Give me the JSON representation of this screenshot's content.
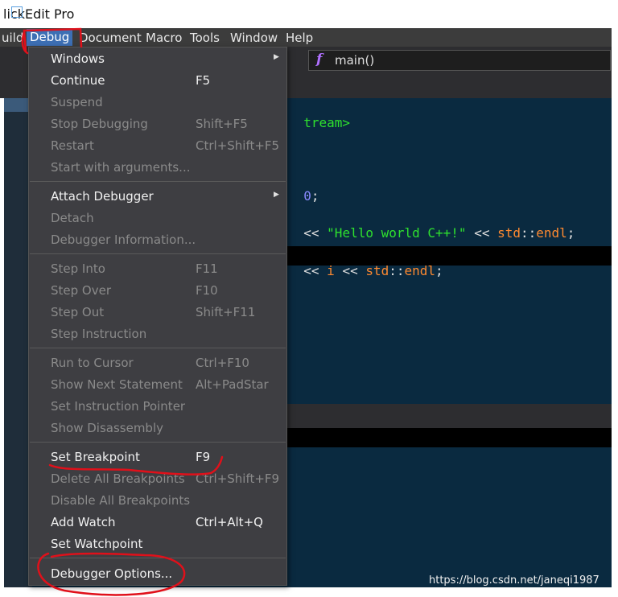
{
  "window": {
    "title": "lickEdit Pro"
  },
  "menubar": {
    "items": [
      "uild",
      "Debug",
      "Document",
      "Macro",
      "Tools",
      "Window",
      "Help"
    ]
  },
  "toolbar": {
    "proc_label": "main()",
    "proc_icon": "f"
  },
  "code": {
    "line1": "tream>",
    "line2_a": "0",
    "line2_b": ";",
    "line3_a": "<< ",
    "line3_str": "\"Hello world C++!\"",
    "line3_b": " << ",
    "line3_std": "std",
    "line3_sep": "::",
    "line3_endl": "endl",
    "line3_end": ";",
    "line4_a": "<< ",
    "line4_i": "i",
    "line4_b": " << ",
    "line4_std": "std",
    "line4_sep": "::",
    "line4_endl": "endl",
    "line4_end": ";"
  },
  "debug_menu": {
    "items": [
      {
        "label": "Windows",
        "shortcut": "",
        "enabled": true,
        "submenu": true
      },
      {
        "label": "Continue",
        "shortcut": "F5",
        "enabled": true
      },
      {
        "label": "Suspend",
        "shortcut": "",
        "enabled": false
      },
      {
        "label": "Stop Debugging",
        "shortcut": "Shift+F5",
        "enabled": false
      },
      {
        "label": "Restart",
        "shortcut": "Ctrl+Shift+F5",
        "enabled": false
      },
      {
        "label": "Start with arguments...",
        "shortcut": "",
        "enabled": false
      },
      {
        "label": "Attach Debugger",
        "shortcut": "",
        "enabled": true,
        "submenu": true
      },
      {
        "label": "Detach",
        "shortcut": "",
        "enabled": false
      },
      {
        "label": "Debugger Information...",
        "shortcut": "",
        "enabled": false
      },
      {
        "label": "Step Into",
        "shortcut": "F11",
        "enabled": false
      },
      {
        "label": "Step Over",
        "shortcut": "F10",
        "enabled": false
      },
      {
        "label": "Step Out",
        "shortcut": "Shift+F11",
        "enabled": false
      },
      {
        "label": "Step Instruction",
        "shortcut": "",
        "enabled": false
      },
      {
        "label": "Run to Cursor",
        "shortcut": "Ctrl+F10",
        "enabled": false
      },
      {
        "label": "Show Next Statement",
        "shortcut": "Alt+PadStar",
        "enabled": false
      },
      {
        "label": "Set Instruction Pointer",
        "shortcut": "",
        "enabled": false
      },
      {
        "label": "Show Disassembly",
        "shortcut": "",
        "enabled": false
      },
      {
        "label": "Set Breakpoint",
        "shortcut": "F9",
        "enabled": true
      },
      {
        "label": "Delete All Breakpoints",
        "shortcut": "Ctrl+Shift+F9",
        "enabled": false
      },
      {
        "label": "Disable All Breakpoints",
        "shortcut": "",
        "enabled": false
      },
      {
        "label": "Add Watch",
        "shortcut": "Ctrl+Alt+Q",
        "enabled": true
      },
      {
        "label": "Set Watchpoint",
        "shortcut": "",
        "enabled": true
      },
      {
        "label": "Debugger Options...",
        "shortcut": "",
        "enabled": true
      }
    ]
  },
  "watermark": "https://blog.csdn.net/janeqi1987",
  "colors": {
    "accent": "#3d6fb4",
    "annotation": "#e0101a",
    "string": "#2ee02e",
    "keyword": "#ff8a30"
  }
}
